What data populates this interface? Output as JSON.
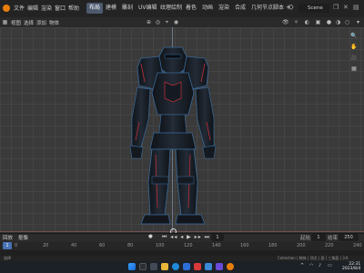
{
  "topbar": {
    "menus": [
      "文件",
      "编辑",
      "渲染",
      "窗口",
      "帮助"
    ],
    "workspaces": [
      "布局",
      "建模",
      "雕刻",
      "UV编辑",
      "纹理绘制",
      "着色",
      "动画",
      "渲染",
      "合成",
      "几何节点",
      "脚本"
    ],
    "plus": "+",
    "scene": "Scene"
  },
  "viewport_header": {
    "menus": [
      "视图",
      "选择",
      "添加",
      "物体"
    ],
    "mode": "物体模式"
  },
  "timeline": {
    "menus": [
      "回放",
      "抠像"
    ],
    "playback_icons": "⏮ ◂◂ ◂ ▶ ▸▸ ⏭",
    "current_frame": "1",
    "start_label": "起始",
    "start": "1",
    "end_label": "结束",
    "end": "250",
    "ticks": [
      "0",
      "20",
      "40",
      "60",
      "80",
      "100",
      "120",
      "140",
      "160",
      "180",
      "200",
      "220",
      "240"
    ]
  },
  "status": {
    "left": "选择",
    "right": "Collection | 物体 | 顶点 | 面 | 三角面 | 3.6"
  },
  "taskbar": {
    "clock_time": "22:31",
    "clock_date": "2023/8/4"
  },
  "colors": {
    "accent": "#4772b3",
    "brand": "#e87d0d",
    "armor_dark": "#1a2028",
    "armor_highlight": "#3a6a9a",
    "armor_red": "#c0303a"
  }
}
